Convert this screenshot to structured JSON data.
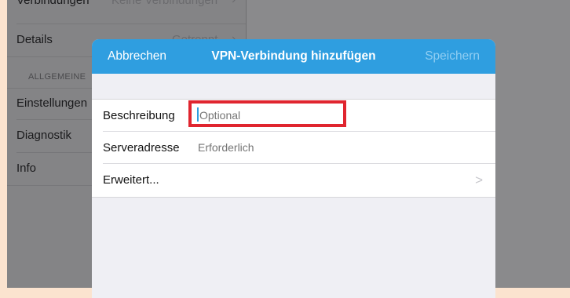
{
  "background_list": {
    "top_row": {
      "label": "Verbindungen",
      "value": "Keine Verbindungen"
    },
    "details": {
      "label": "Details",
      "value": "Getrennt"
    },
    "section_header": "ALLGEMEINE",
    "items": [
      {
        "label": "Einstellungen"
      },
      {
        "label": "Diagnostik"
      },
      {
        "label": "Info"
      }
    ]
  },
  "modal": {
    "cancel_label": "Abbrechen",
    "title": "VPN-Verbindung hinzufügen",
    "save_label": "Speichern",
    "fields": {
      "description": {
        "label": "Beschreibung",
        "placeholder": "Optional",
        "value": ""
      },
      "server": {
        "label": "Serveradresse",
        "placeholder": "Erforderlich",
        "value": ""
      }
    },
    "advanced_label": "Erweitert...",
    "advanced_chevron": ">"
  },
  "colors": {
    "nav_bar": "#2f9ee0",
    "save_disabled": "#8fcdf2",
    "highlight": "#e0252f"
  }
}
